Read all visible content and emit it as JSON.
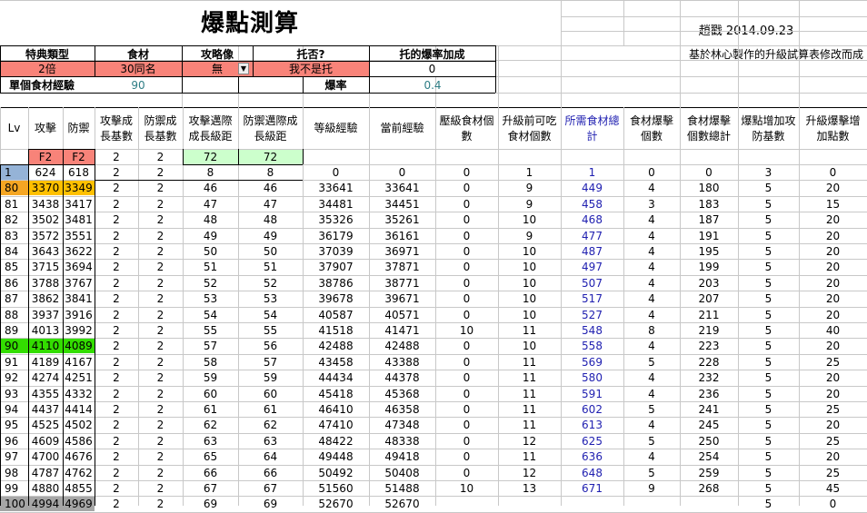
{
  "title": "爆點測算",
  "author_date": "趙戳 2014.09.23",
  "note": "基於林心製作的升級試算表修改而成",
  "params": {
    "labels": [
      "特典類型",
      "食材",
      "攻略像",
      "托否?",
      "托的爆率加成"
    ],
    "values": [
      "2倍",
      "30同名",
      "無",
      "我不是托",
      "0"
    ],
    "exp_label": "單個食材經驗",
    "exp_value": "90",
    "rate_label": "爆率",
    "rate_value": "0.4"
  },
  "columns": [
    "Lv",
    "攻擊",
    "防禦",
    "攻擊成長基數",
    "防禦成長基數",
    "攻擊邁際成長級距",
    "防禦邁際成長級距",
    "等級經驗",
    "當前經驗",
    "壓級食材個數",
    "升級前可吃食材個數",
    "所需食材總計",
    "食材爆擊個數",
    "食材爆擊個數總計",
    "爆點增加攻防基數",
    "升級爆擊增加點數"
  ],
  "f2_row": [
    "",
    "F2",
    "F2",
    "2",
    "2",
    "72",
    "72",
    "",
    "",
    "",
    "",
    "",
    "",
    "",
    "",
    ""
  ],
  "rows": [
    [
      "1",
      "624",
      "618",
      "2",
      "2",
      "8",
      "8",
      "0",
      "0",
      "0",
      "1",
      "1",
      "0",
      "0",
      "3",
      "0"
    ],
    [
      "80",
      "3370",
      "3349",
      "2",
      "2",
      "46",
      "46",
      "33641",
      "33641",
      "0",
      "9",
      "449",
      "4",
      "180",
      "5",
      "20"
    ],
    [
      "81",
      "3438",
      "3417",
      "2",
      "2",
      "47",
      "47",
      "34481",
      "34451",
      "0",
      "9",
      "458",
      "3",
      "183",
      "5",
      "15"
    ],
    [
      "82",
      "3502",
      "3481",
      "2",
      "2",
      "48",
      "48",
      "35326",
      "35261",
      "0",
      "10",
      "468",
      "4",
      "187",
      "5",
      "20"
    ],
    [
      "83",
      "3572",
      "3551",
      "2",
      "2",
      "49",
      "49",
      "36179",
      "36161",
      "0",
      "9",
      "477",
      "4",
      "191",
      "5",
      "20"
    ],
    [
      "84",
      "3643",
      "3622",
      "2",
      "2",
      "50",
      "50",
      "37039",
      "36971",
      "0",
      "10",
      "487",
      "4",
      "195",
      "5",
      "20"
    ],
    [
      "85",
      "3715",
      "3694",
      "2",
      "2",
      "51",
      "51",
      "37907",
      "37871",
      "0",
      "10",
      "497",
      "4",
      "199",
      "5",
      "20"
    ],
    [
      "86",
      "3788",
      "3767",
      "2",
      "2",
      "52",
      "52",
      "38786",
      "38771",
      "0",
      "10",
      "507",
      "4",
      "203",
      "5",
      "20"
    ],
    [
      "87",
      "3862",
      "3841",
      "2",
      "2",
      "53",
      "53",
      "39678",
      "39671",
      "0",
      "10",
      "517",
      "4",
      "207",
      "5",
      "20"
    ],
    [
      "88",
      "3937",
      "3916",
      "2",
      "2",
      "54",
      "54",
      "40587",
      "40571",
      "0",
      "10",
      "527",
      "4",
      "211",
      "5",
      "20"
    ],
    [
      "89",
      "4013",
      "3992",
      "2",
      "2",
      "55",
      "55",
      "41518",
      "41471",
      "10",
      "11",
      "548",
      "8",
      "219",
      "5",
      "40"
    ],
    [
      "90",
      "4110",
      "4089",
      "2",
      "2",
      "57",
      "56",
      "42488",
      "42488",
      "0",
      "10",
      "558",
      "4",
      "223",
      "5",
      "20"
    ],
    [
      "91",
      "4189",
      "4167",
      "2",
      "2",
      "58",
      "57",
      "43458",
      "43388",
      "0",
      "11",
      "569",
      "5",
      "228",
      "5",
      "25"
    ],
    [
      "92",
      "4274",
      "4251",
      "2",
      "2",
      "59",
      "59",
      "44434",
      "44378",
      "0",
      "11",
      "580",
      "4",
      "232",
      "5",
      "20"
    ],
    [
      "93",
      "4355",
      "4332",
      "2",
      "2",
      "60",
      "60",
      "45418",
      "45368",
      "0",
      "11",
      "591",
      "4",
      "236",
      "5",
      "20"
    ],
    [
      "94",
      "4437",
      "4414",
      "2",
      "2",
      "61",
      "61",
      "46410",
      "46358",
      "0",
      "11",
      "602",
      "5",
      "241",
      "5",
      "25"
    ],
    [
      "95",
      "4525",
      "4502",
      "2",
      "2",
      "62",
      "62",
      "47410",
      "47348",
      "0",
      "11",
      "613",
      "4",
      "245",
      "5",
      "20"
    ],
    [
      "96",
      "4609",
      "4586",
      "2",
      "2",
      "63",
      "63",
      "48422",
      "48338",
      "0",
      "12",
      "625",
      "5",
      "250",
      "5",
      "25"
    ],
    [
      "97",
      "4700",
      "4676",
      "2",
      "2",
      "65",
      "64",
      "49448",
      "49418",
      "0",
      "11",
      "636",
      "4",
      "254",
      "5",
      "20"
    ],
    [
      "98",
      "4787",
      "4762",
      "2",
      "2",
      "66",
      "66",
      "50492",
      "50408",
      "0",
      "12",
      "648",
      "5",
      "259",
      "5",
      "25"
    ],
    [
      "99",
      "4880",
      "4855",
      "2",
      "2",
      "67",
      "67",
      "51560",
      "51488",
      "10",
      "13",
      "671",
      "9",
      "268",
      "5",
      "45"
    ],
    [
      "100",
      "4994",
      "4969",
      "2",
      "2",
      "69",
      "69",
      "52670",
      "52670",
      "",
      "",
      "",
      "",
      "",
      "5",
      "0"
    ]
  ],
  "colors": {
    "pink": "#f88379",
    "light_green": "#ccffcc",
    "blue_lv": "#95b3d7",
    "orange": "#f5a623",
    "gold": "#ffc000",
    "bright_green": "#33dd00",
    "gray": "#a6a6a6",
    "blue_text": "#1f1fb0",
    "teal_text": "#2e7d85"
  }
}
